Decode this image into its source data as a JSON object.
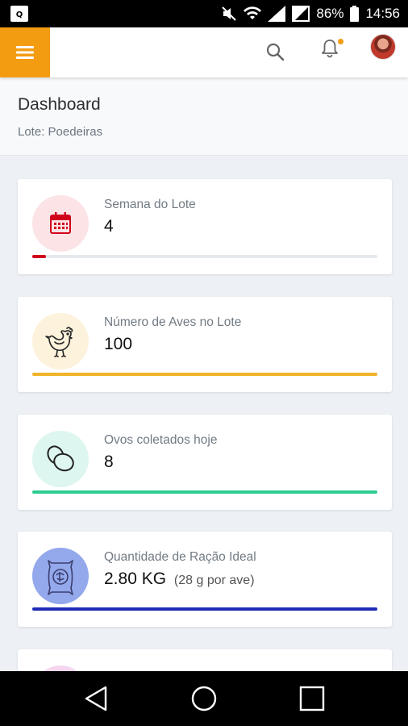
{
  "status_bar": {
    "battery": "86%",
    "time": "14:56"
  },
  "app_bar": {
    "menu_icon": "hamburger-menu-icon",
    "search_icon": "search-icon",
    "bell_icon": "bell-icon",
    "accent": "#f39c12"
  },
  "page": {
    "title": "Dashboard",
    "subtitle": "Lote: Poedeiras"
  },
  "cards": [
    {
      "label": "Semana do Lote",
      "value": "4",
      "icon": "calendar-icon",
      "icon_bg": "#fbe3e6",
      "bar_color": "#d0021b",
      "progress": 0.04
    },
    {
      "label": "Número de Aves no Lote",
      "value": "100",
      "icon": "chicken-icon",
      "icon_bg": "#fdf2dc",
      "bar_color": "#f0b429",
      "progress": 1.0
    },
    {
      "label": "Ovos coletados hoje",
      "value": "8",
      "icon": "eggs-icon",
      "icon_bg": "#ddf6ef",
      "bar_color": "#2ecc8f",
      "progress": 1.0
    },
    {
      "label": "Quantidade de Ração Ideal",
      "value": "2.80 KG",
      "value_note": "(28 g por ave)",
      "icon": "feed-bag-icon",
      "icon_bg": "#94a8ec",
      "bar_color": "#1f2bb3",
      "progress": 1.0
    }
  ],
  "nav_bar": {
    "back_icon": "back-icon",
    "home_icon": "home-icon",
    "recents_icon": "recents-icon"
  }
}
